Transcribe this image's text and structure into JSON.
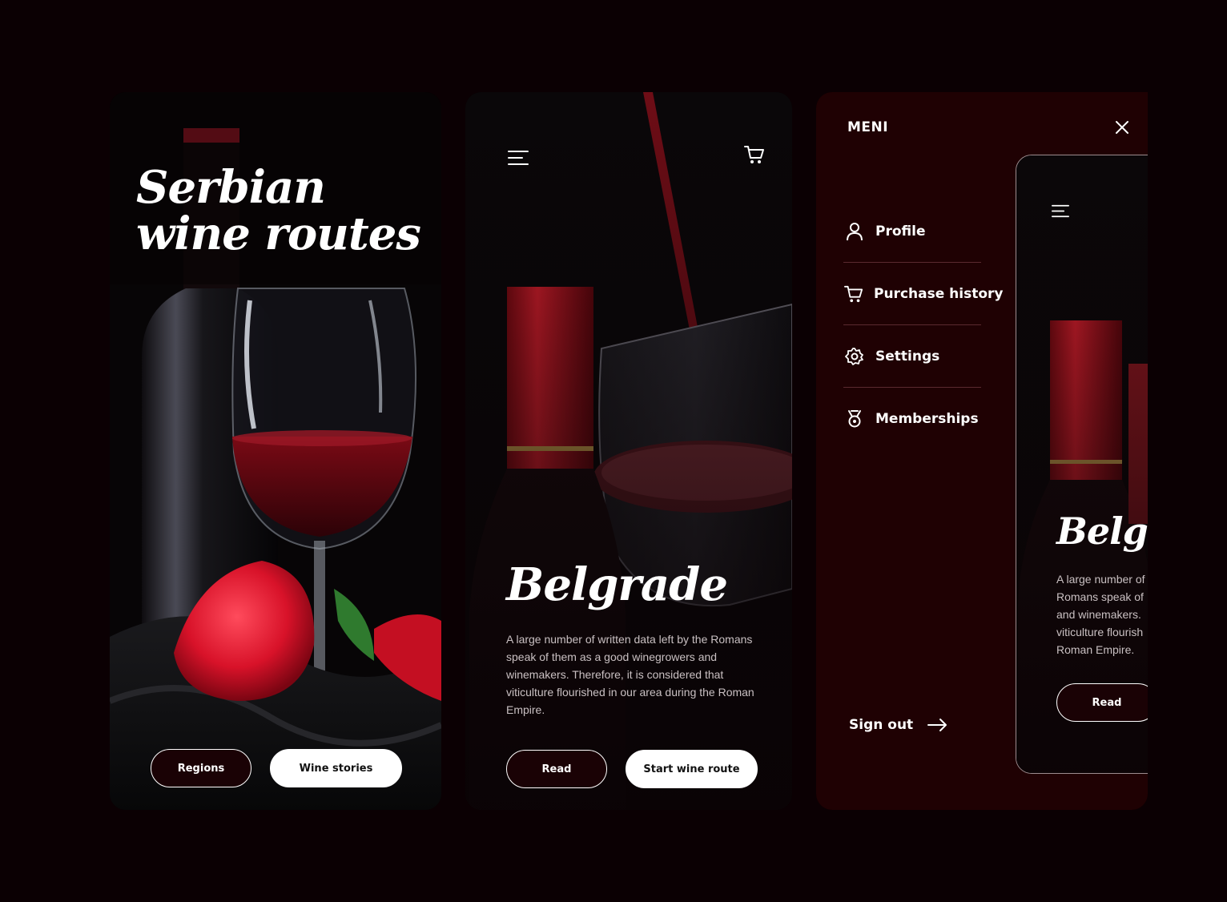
{
  "screen1": {
    "title": "Serbian wine routes",
    "buttons": {
      "regions": "Regions",
      "wine_stories": "Wine stories"
    }
  },
  "screen2": {
    "city": "Belgrade",
    "description": "A large number of written data left by the Romans speak of them as a good winegrowers and winemakers. Therefore, it is considered that viticulture flourished in our area during the Roman Empire.",
    "buttons": {
      "read": "Read",
      "start_route": "Start wine route"
    },
    "icons": {
      "menu": "hamburger-menu-icon",
      "cart": "cart-icon"
    }
  },
  "menu": {
    "title": "MENI",
    "items": [
      {
        "label": "Profile",
        "icon": "user-icon"
      },
      {
        "label": "Purchase history",
        "icon": "cart-icon"
      },
      {
        "label": "Settings",
        "icon": "gear-icon"
      },
      {
        "label": "Memberships",
        "icon": "medal-icon"
      }
    ],
    "sign_out": "Sign out",
    "preview": {
      "city": "Belgrade",
      "lines": [
        "A large number of",
        "Romans speak of",
        "and winemakers.",
        "viticulture flourish",
        "Roman Empire."
      ],
      "read": "Read"
    }
  },
  "colors": {
    "page_bg": "#0b0003",
    "menu_bg": "#1f0103",
    "wine_red": "#b0121e",
    "button_dark": "#1a0205"
  }
}
